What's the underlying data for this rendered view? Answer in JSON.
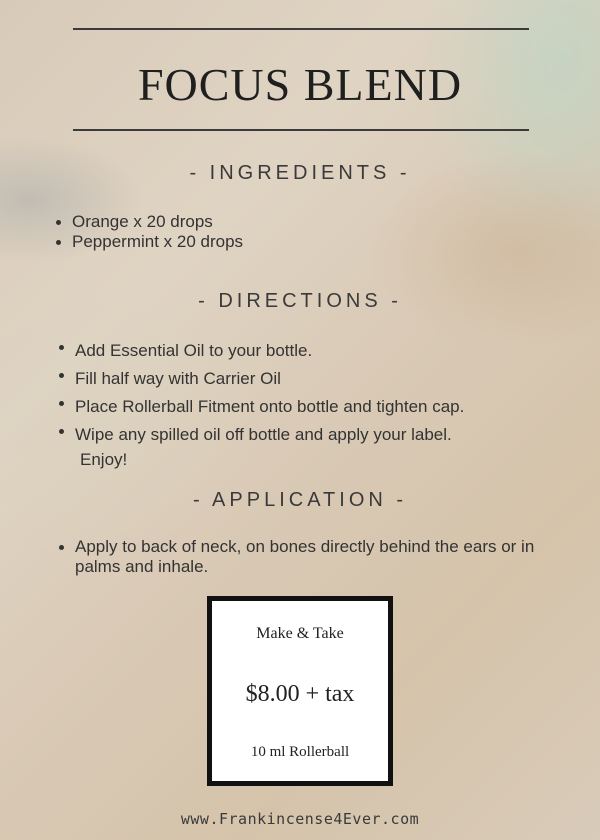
{
  "title": "FOCUS BLEND",
  "ingredients": {
    "heading": "- INGREDIENTS -",
    "items": [
      "Orange x 20 drops",
      "Peppermint x 20 drops"
    ]
  },
  "directions": {
    "heading": "- DIRECTIONS -",
    "items": [
      "Add Essential Oil to your bottle.",
      "Fill half way with Carrier Oil",
      "Place Rollerball Fitment onto bottle and tighten cap.",
      "Wipe any spilled oil off bottle and apply your label."
    ],
    "closing": "Enjoy!"
  },
  "application": {
    "heading": "- APPLICATION -",
    "items": [
      "Apply to back of neck, on bones directly behind the ears or in palms and inhale."
    ]
  },
  "price_box": {
    "top": "Make & Take",
    "price": "$8.00 + tax",
    "bottom": "10 ml Rollerball"
  },
  "footer": "www.Frankincense4Ever.com"
}
